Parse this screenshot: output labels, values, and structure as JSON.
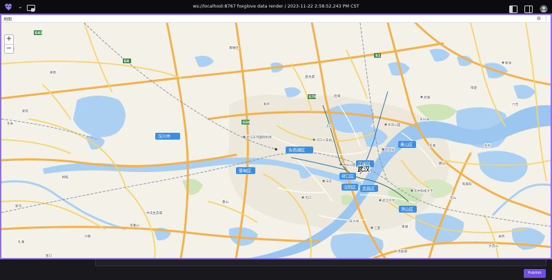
{
  "topbar": {
    "title": "ws://localhost:8767 foxglove data render / 2023-11-22 2:58:52.243 PM CST"
  },
  "panel": {
    "title": "地图",
    "settings_icon": "gear-icon",
    "menu_icon": "more-icon"
  },
  "map": {
    "zoom_in": "+",
    "zoom_out": "−",
    "labels": {
      "wuhan": "武汉",
      "jiangan": "江岸区",
      "qiaokou": "硚口区",
      "hanyang": "汉阳区",
      "wuchang": "武昌区",
      "qingshan": "青山区",
      "hongshan": "洪山区",
      "dongxihu": "东西湖区",
      "caidian": "蔡甸区",
      "hanchuan": "汉川市",
      "tianhe": "武汉天河国际机场",
      "hankou_station": "汉口火车站",
      "wuchang_station": "武昌站",
      "guanggu": "光谷",
      "huazhong": "华中科技大学",
      "wuhan_univ": "武汉大学",
      "zhongshan": "中山公园",
      "dongjingyuan": "东风公园",
      "tianxingzhou": "天兴洲",
      "wuhu": "武湖",
      "xinzhou": "新洲",
      "zhuankou": "沌口",
      "baiyun": "白云",
      "jiangxia": "江夏",
      "hankou": "汉口",
      "houhu": "后湖",
      "panlongcheng": "盘龙城",
      "zhongfa": "中法生态城",
      "chenjiaji": "陈家矶",
      "liuhe": "六合",
      "xinnong": "新农",
      "maocao": "茅草",
      "dongguan": "东关",
      "xiaogan": "孝感",
      "huangpi": "黄陂区",
      "yangluo": "阳逻",
      "zuoling": "左岭",
      "huashan": "花山",
      "baishazhou": "白沙洲",
      "nanhu": "南湖",
      "tangxunhu": "汤逊湖",
      "donghu": "东湖",
      "moshan": "磨山",
      "liuzhi": "柳枝",
      "fenghuang": "凤凰山",
      "guanqiao": "关桥",
      "dahua": "大花山",
      "lushan": "鲁山",
      "shamao": "沙帽",
      "jinkou": "金口",
      "xingou": "新沟",
      "zhahu": "扎湖",
      "hexin": "和平"
    },
    "roads": {
      "g4": "G4",
      "g42": "G42",
      "g50": "G50",
      "g70": "G70",
      "s1": "S1"
    }
  },
  "bottom": {
    "publish_label": "Publish"
  }
}
